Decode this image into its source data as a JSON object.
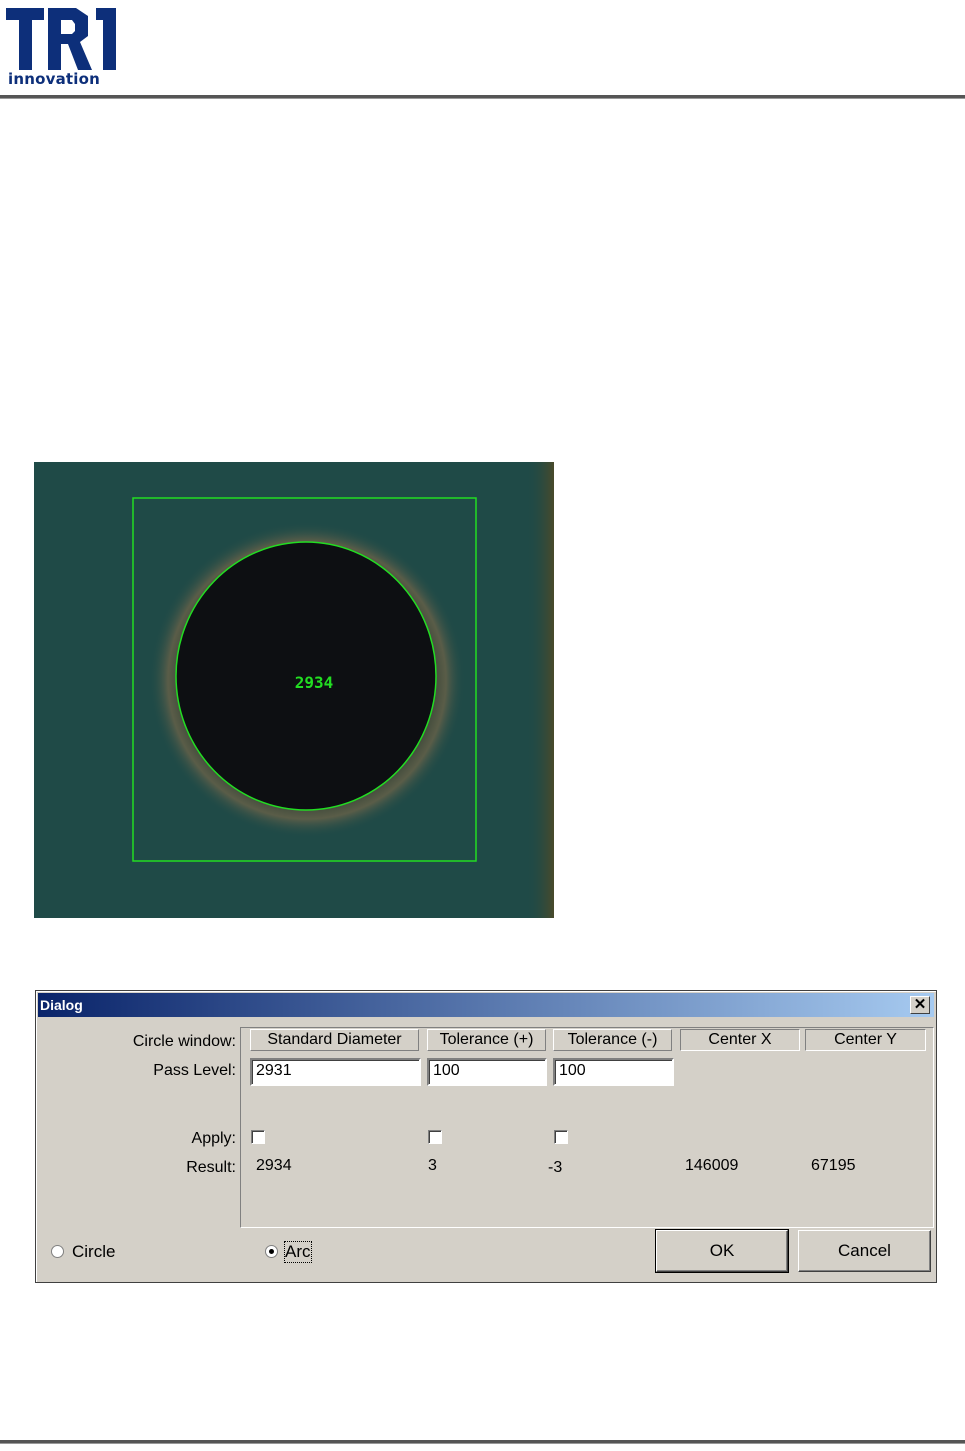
{
  "header": {
    "logo_main": "TRI",
    "logo_sub": "innovation"
  },
  "inspection": {
    "measured_value": "2934"
  },
  "dialog": {
    "title": "Dialog",
    "close_label": "✕",
    "labels": {
      "circle_window": "Circle window:",
      "pass_level": "Pass Level:",
      "apply": "Apply:",
      "result": "Result:"
    },
    "columns": [
      "Standard Diameter",
      "Tolerance (+)",
      "Tolerance (-)",
      "Center X",
      "Center Y"
    ],
    "pass_level": {
      "standard_diameter": "2931",
      "tolerance_plus": "100",
      "tolerance_minus": "100"
    },
    "apply": {
      "standard_diameter": false,
      "tolerance_plus": false,
      "tolerance_minus": false
    },
    "results": {
      "standard_diameter": "2934",
      "tolerance_plus": "3",
      "tolerance_minus": "-3",
      "center_x": "146009",
      "center_y": "67195"
    },
    "mode": {
      "circle_label": "Circle",
      "arc_label": "Arc",
      "selected": "Arc"
    },
    "buttons": {
      "ok": "OK",
      "cancel": "Cancel"
    }
  }
}
